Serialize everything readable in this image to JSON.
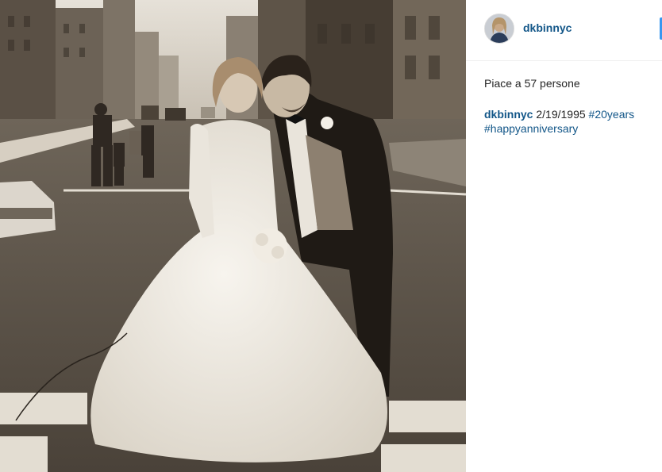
{
  "post": {
    "photo_alt": "",
    "colors": {
      "sepia_dark": "#2a241e",
      "sepia_mid": "#8f8476",
      "sepia_light": "#d9d2c6",
      "link": "#125688",
      "follow_blue": "#3897f0"
    }
  },
  "header": {
    "username": "dkbinnyc",
    "avatar_icon": "user-avatar"
  },
  "likes": {
    "text": "Piace a 57 persone"
  },
  "caption": {
    "author": "dkbinnyc",
    "date_text": "2/19/1995",
    "hashtags": [
      "#20years",
      "#happyanniversary"
    ]
  }
}
